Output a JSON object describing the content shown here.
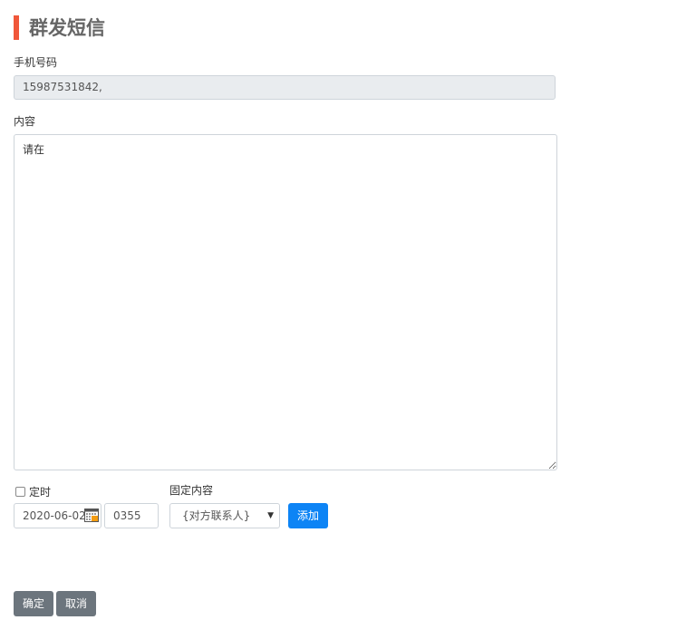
{
  "header": {
    "title": "群发短信",
    "accent_color": "#f0573a"
  },
  "phone": {
    "label": "手机号码",
    "value": "15987531842,"
  },
  "content": {
    "label": "内容",
    "value": "请在"
  },
  "schedule": {
    "timer_label": "定时",
    "timer_checked": false,
    "date_value": "2020-06-02",
    "time_value": "0355",
    "calendar_icon": "calendar-icon"
  },
  "fixed_content": {
    "label": "固定内容",
    "selected": "{对方联系人}",
    "add_button": "添加"
  },
  "actions": {
    "confirm": "确定",
    "cancel": "取消"
  },
  "colors": {
    "primary": "#0d84f5",
    "secondary": "#6c757d",
    "readonly_bg": "#e9ecef"
  }
}
